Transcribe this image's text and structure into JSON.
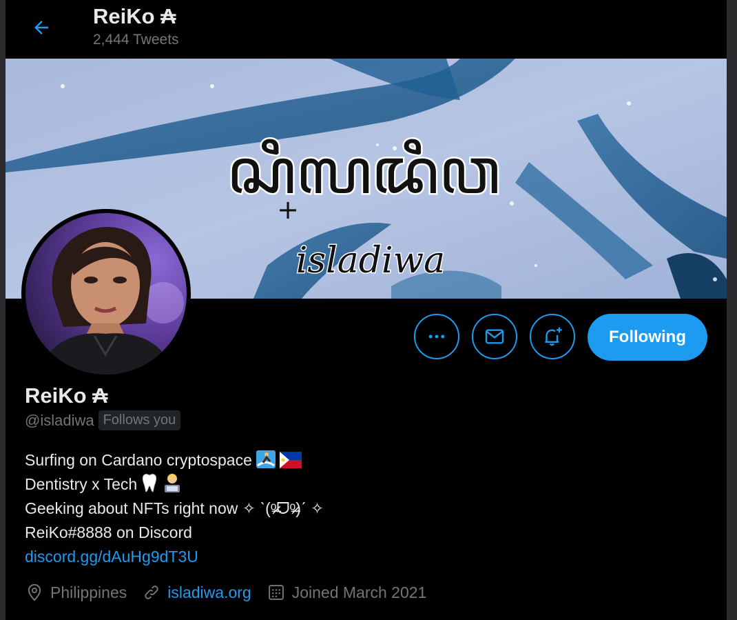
{
  "header": {
    "back_icon": "arrow-left-icon",
    "display_name": "ReiKo ₳",
    "tweet_count": "2,444 Tweets"
  },
  "banner": {
    "script_text": "ꦱꦶꦭꦢꦶꦮ",
    "caption": "isladiwa"
  },
  "actions": {
    "more_icon": "more-dots-icon",
    "message_icon": "mail-icon",
    "notify_icon": "bell-plus-icon",
    "follow_label": "Following"
  },
  "profile": {
    "name": "ReiKo ₳",
    "handle": "@isladiwa",
    "follows_you": "Follows you",
    "bio": [
      "Surfing on Cardano cryptospace",
      "Dentistry x Tech",
      "Geeking about NFTs right now ✧ ˋ(ᵒ̴̶̷ᗜᵒ̴̶̷)ˊ ✧",
      "ReiKo#8888 on Discord"
    ],
    "bio_link": "discord.gg/dAuHg9dT3U",
    "location": "Philippines",
    "website": "isladiwa.org",
    "joined": "Joined March 2021"
  },
  "colors": {
    "accent": "#1d9bf0",
    "background": "#000000",
    "muted_text": "#71767b"
  }
}
